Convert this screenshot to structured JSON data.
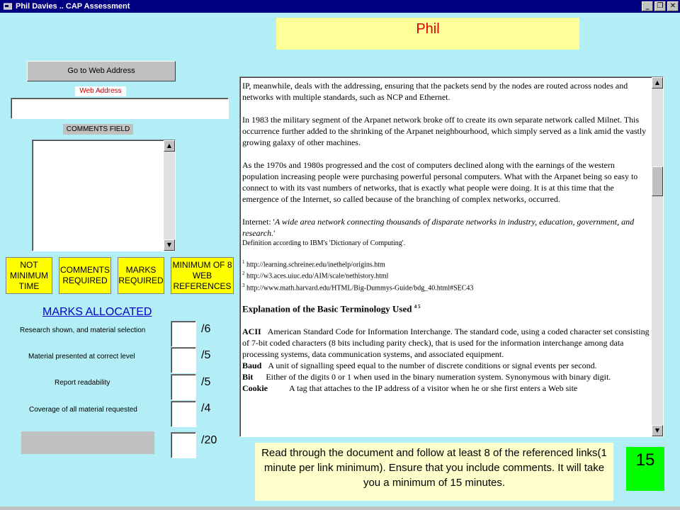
{
  "window": {
    "title": "Phil Davies .. CAP Assessment",
    "controls": {
      "minimize": "_",
      "restore": "❐",
      "close": "✕"
    }
  },
  "student_name": "Phil",
  "go_button": "Go to Web Address",
  "web_address": {
    "label": "Web Address",
    "value": ""
  },
  "comments": {
    "label": "COMMENTS FIELD",
    "value": ""
  },
  "warnings": [
    {
      "line1": "NOT",
      "line2": "MINIMUM",
      "line3": "TIME"
    },
    {
      "line1": "COMMENTS",
      "line2": "REQUIRED",
      "line3": ""
    },
    {
      "line1": "MARKS",
      "line2": "REQUIRED",
      "line3": ""
    },
    {
      "line1": "MINIMUM OF 8",
      "line2": "WEB",
      "line3": "REFERENCES"
    }
  ],
  "marks": {
    "title": "MARKS ALLOCATED",
    "rows": [
      {
        "label": "Research shown, and material selection",
        "max": "/6"
      },
      {
        "label": "Material presented at correct  level",
        "max": "/5"
      },
      {
        "label": "Report readability",
        "max": "/5"
      },
      {
        "label": "Coverage of all material requested",
        "max": "/4"
      }
    ],
    "total": "/20"
  },
  "document": {
    "p1": "IP, meanwhile, deals with the addressing, ensuring that the packets send by the nodes are routed across nodes and networks with multiple standards, such as NCP and Ethernet.",
    "p2": "In 1983 the military segment of the Arpanet network broke off to create its own separate network called Milnet. This occurrence further added to the shrinking of the Arpanet neighbourhood, which simply served as a link amid the vastly growing galaxy of other machines.",
    "p3": "As the 1970s and 1980s progressed and the cost of computers declined along with the earnings of the western population increasing people were purchasing powerful personal computers. What with the Arpanet being so easy to connect to with its vast numbers of networks, that is exactly what people were doing. It is at this time that the emergence of the Internet, so called because of the branching of complex networks, occurred.",
    "internet_prefix": "Internet: '",
    "internet_quote": "A wide area network connecting thousands of disparate networks in industry, education, government, and research.",
    "internet_suffix": "'",
    "definition": "Definition according to IBM's 'Dictionary of Computing'.",
    "refs": [
      {
        "num": "1",
        "url": "http://learning.schreiner.edu/inethelp/origins.htm"
      },
      {
        "num": "2",
        "url": "http://w3.aces.uiuc.edu/AIM/scale/nethistory.html"
      },
      {
        "num": "3",
        "url": "http://www.math.harvard.edu/HTML/Big-Dummys-Guide/bdg_40.html#SEC43"
      }
    ],
    "heading": "Explanation of the Basic Terminology Used",
    "heading_sup": "4 5",
    "terms": [
      {
        "term": "ACII",
        "def": "American Standard Code for Information Interchange. The standard code, using a coded character set consisting of 7-bit coded characters (8 bits including parity check), that is used for the information interchange among data processing systems, data communication systems, and associated equipment."
      },
      {
        "term": "Baud",
        "def": "A unit of signalling speed equal to the number of discrete conditions or signal events per second."
      },
      {
        "term": "Bit",
        "def": "Either of the digits 0 or 1 when used in the binary numeration system. Synonymous with binary digit."
      },
      {
        "term": "Cookie",
        "def": "A tag that attaches to the IP address of a visitor when he or she first enters a Web site"
      }
    ]
  },
  "instructions": "Read through the document and follow at least 8 of the referenced links(1 minute per link minimum). Ensure that you include comments. It will take you a minimum of 15 minutes.",
  "timer": "15",
  "colors": {
    "titlebar": "#000080",
    "background": "#b3eef6",
    "warning": "#ffff00",
    "timer": "#00ff00",
    "name_text": "#e00000"
  }
}
